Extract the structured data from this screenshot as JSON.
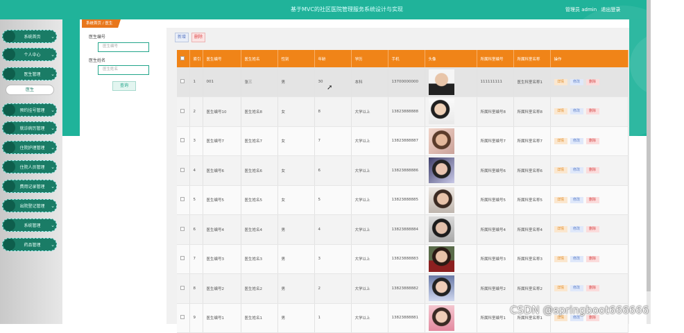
{
  "header": {
    "title": "基于MVC的社区医院管理服务系统设计与实现",
    "user_label": "管理员 admin",
    "logout_label": "退出登录"
  },
  "sidebar": {
    "items": [
      {
        "label": "系统首页"
      },
      {
        "label": "个人中心"
      },
      {
        "label": "医生管理"
      },
      {
        "label": "预约挂号管理"
      },
      {
        "label": "就诊病历管理"
      },
      {
        "label": "住院护理管理"
      },
      {
        "label": "住院人员管理"
      },
      {
        "label": "费用记录管理"
      },
      {
        "label": "出院登记管理"
      },
      {
        "label": "系统管理"
      },
      {
        "label": "药品管理"
      }
    ],
    "submenu_label": "医生"
  },
  "breadcrumb": {
    "home": "系统首页",
    "current": "医生"
  },
  "search": {
    "field1_label": "医生编号",
    "field1_placeholder": "医生编号",
    "field2_label": "医生姓名",
    "field2_placeholder": "医生姓名",
    "button_label": "查询"
  },
  "toolbar": {
    "add_label": "新增",
    "delete_label": "删除"
  },
  "table": {
    "headers": [
      "",
      "索引",
      "医生编号",
      "医生姓名",
      "性别",
      "年龄",
      "学历",
      "手机",
      "头像",
      "所属科室编号",
      "所属科室名称",
      "操作"
    ],
    "actions": [
      "详情",
      "修改",
      "删除"
    ],
    "rows": [
      {
        "index": "1",
        "code": "001",
        "name": "张三",
        "gender": "男",
        "age": "30",
        "edu": "本科",
        "phone": "13700000000",
        "dept_code": "111111111",
        "dept_name": "医生科室名称1"
      },
      {
        "index": "2",
        "code": "医生编号10",
        "name": "医生姓名8",
        "gender": "女",
        "age": "8",
        "edu": "大学以上",
        "phone": "13823888888",
        "dept_code": "所属科室编号8",
        "dept_name": "所属科室名称8"
      },
      {
        "index": "3",
        "code": "医生编号7",
        "name": "医生姓名7",
        "gender": "女",
        "age": "7",
        "edu": "大学以上",
        "phone": "13823888887",
        "dept_code": "所属科室编号7",
        "dept_name": "所属科室名称7"
      },
      {
        "index": "4",
        "code": "医生编号6",
        "name": "医生姓名6",
        "gender": "女",
        "age": "6",
        "edu": "大学以上",
        "phone": "13823888886",
        "dept_code": "所属科室编号6",
        "dept_name": "所属科室名称6"
      },
      {
        "index": "5",
        "code": "医生编号5",
        "name": "医生姓名5",
        "gender": "女",
        "age": "5",
        "edu": "大学以上",
        "phone": "13823888885",
        "dept_code": "所属科室编号5",
        "dept_name": "所属科室名称5"
      },
      {
        "index": "6",
        "code": "医生编号4",
        "name": "医生姓名4",
        "gender": "男",
        "age": "4",
        "edu": "大学以上",
        "phone": "13823888884",
        "dept_code": "所属科室编号4",
        "dept_name": "所属科室名称4"
      },
      {
        "index": "7",
        "code": "医生编号3",
        "name": "医生姓名3",
        "gender": "男",
        "age": "3",
        "edu": "大学以上",
        "phone": "13823888883",
        "dept_code": "所属科室编号3",
        "dept_name": "所属科室名称3"
      },
      {
        "index": "8",
        "code": "医生编号2",
        "name": "医生姓名2",
        "gender": "男",
        "age": "2",
        "edu": "大学以上",
        "phone": "13823888882",
        "dept_code": "所属科室编号2",
        "dept_name": "所属科室名称2"
      },
      {
        "index": "9",
        "code": "医生编号1",
        "name": "医生姓名1",
        "gender": "男",
        "age": "1",
        "edu": "大学以上",
        "phone": "13823888881",
        "dept_code": "所属科室编号1",
        "dept_name": "所属科室名称1"
      }
    ]
  },
  "watermark": "CSDN @springboot666666",
  "colors": {
    "primary": "#20b39a",
    "header_orange": "#f08418",
    "sidebar_menu": "#1a7c66"
  }
}
